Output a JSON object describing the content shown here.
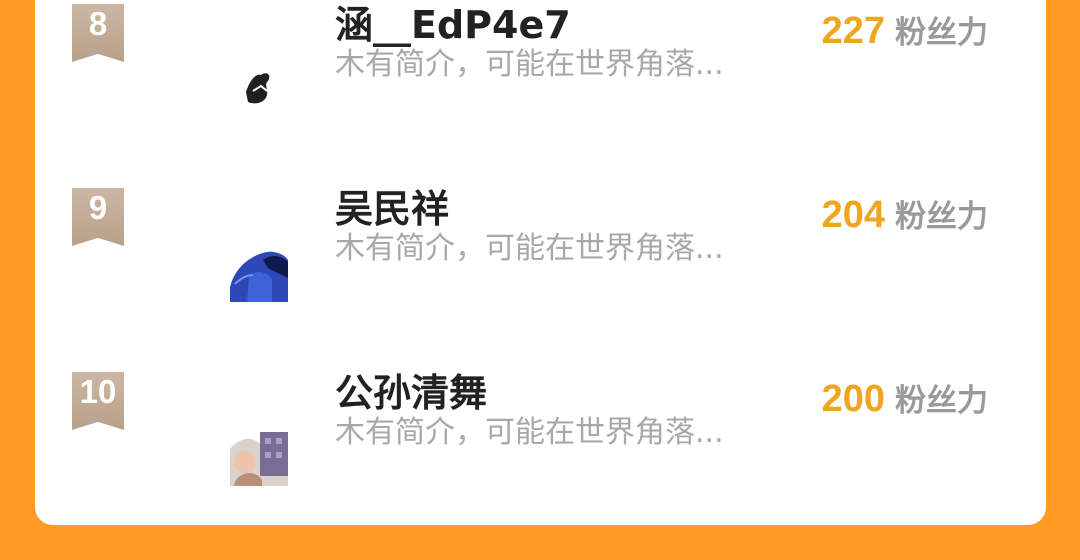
{
  "leaderboard": {
    "rows": [
      {
        "rank": "8",
        "name": "涵__EdP4e7",
        "bio": "木有简介，可能在世界角落...",
        "fans": "227",
        "unit": "粉丝力",
        "avatar": "dark-figure-avatar"
      },
      {
        "rank": "9",
        "name": "吴民祥",
        "bio": "木有简介，可能在世界角落...",
        "fans": "204",
        "unit": "粉丝力",
        "avatar": "blue-figure-avatar"
      },
      {
        "rank": "10",
        "name": "公孙清舞",
        "bio": "木有简介，可能在世界角落...",
        "fans": "200",
        "unit": "粉丝力",
        "avatar": "outdoor-photo-avatar"
      }
    ]
  },
  "colors": {
    "background": "#ff9a22",
    "card": "#ffffff",
    "fans_number": "#f0a51f",
    "rank_badge": "#c4ae98",
    "name_text": "#222222",
    "secondary_text": "#a8a8a8"
  }
}
